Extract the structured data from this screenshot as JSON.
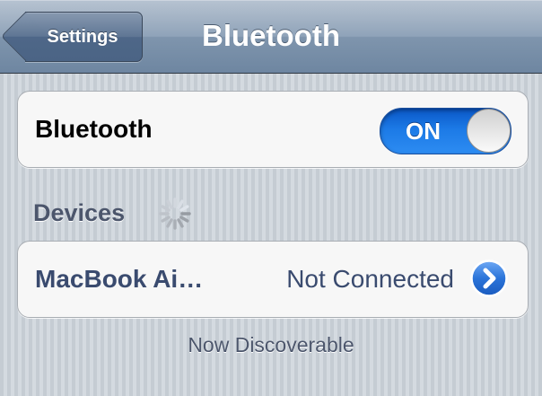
{
  "navbar": {
    "back_label": "Settings",
    "title": "Bluetooth"
  },
  "bluetooth_row": {
    "label": "Bluetooth",
    "toggle_label": "ON",
    "toggle_state": "on"
  },
  "devices_section": {
    "header": "Devices",
    "icon": "loading-spinner-icon"
  },
  "devices": [
    {
      "name": "MacBook Ai…",
      "status": "Not Connected",
      "icon": "detail-disclosure-icon"
    }
  ],
  "footer": "Now Discoverable",
  "colors": {
    "navbar": "#7f95ad",
    "toggle_on": "#1c7ae6",
    "device_text": "#3a4b6f",
    "section_header": "#4c566c"
  }
}
